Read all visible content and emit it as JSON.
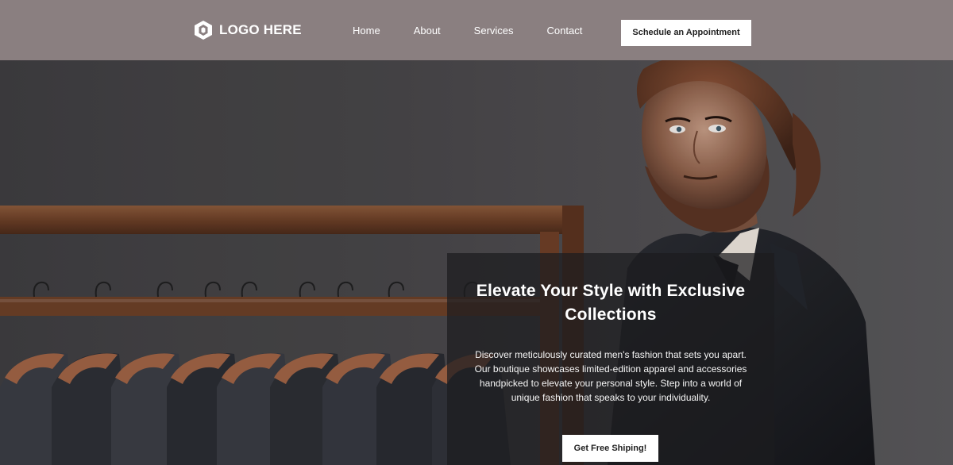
{
  "header": {
    "logo_text": "LOGO HERE",
    "nav": [
      {
        "label": "Home"
      },
      {
        "label": "About"
      },
      {
        "label": "Services"
      },
      {
        "label": "Contact"
      }
    ],
    "cta_label": "Schedule an Appointment"
  },
  "hero": {
    "title": "Elevate Your Style with Exclusive Collections",
    "copy": "Discover meticulously curated men's fashion that sets you apart. Our boutique showcases limited-edition apparel and accessories handpicked to elevate your personal style. Step into a world of unique fashion that speaks to your individuality.",
    "button_label": "Get Free Shiping!"
  },
  "colors": {
    "header_bg": "#8a7f80",
    "accent_white": "#ffffff",
    "overlay": "#1c1c1e"
  },
  "icons": {
    "logo": "hexagon-logo-icon"
  }
}
